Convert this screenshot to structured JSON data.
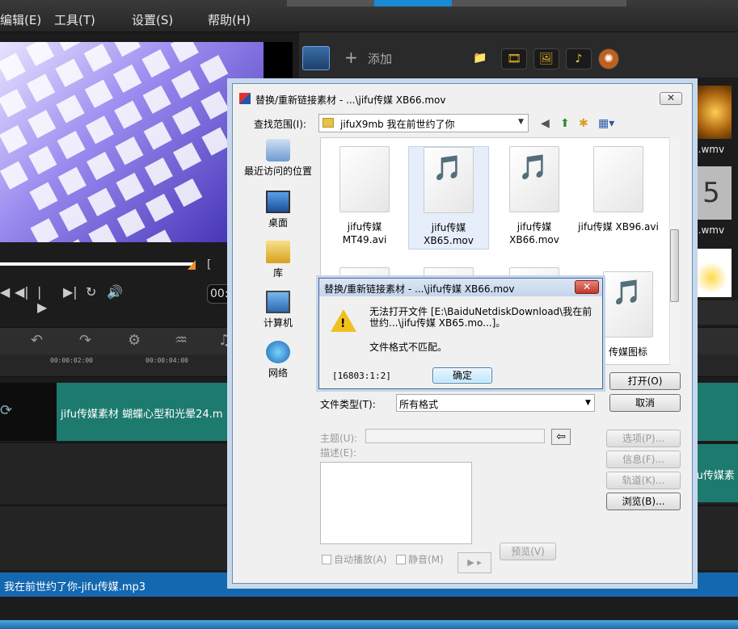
{
  "menu": {
    "edit": "编辑(E)",
    "tools": "工具(T)",
    "settings": "设置(S)",
    "help": "帮助(H)"
  },
  "player": {
    "timecode": "00:"
  },
  "library": {
    "add_label": "添加",
    "thumb1_label": "5.wmv",
    "thumb2_label": "2.wmv",
    "thumb2_text": "5"
  },
  "timeline": {
    "ticks": [
      "00:00:02:00",
      "00:00:04:00"
    ],
    "clip1": "jifu传媒素材 蝴蝶心型和光晕24.m",
    "clip2": "fu传媒素",
    "audio": "我在前世约了你-jifu传媒.mp3"
  },
  "dialog": {
    "title": "替换/重新链接素材 -    ...\\jifu传媒 XB66.mov",
    "close": "✕",
    "lookin_label": "查找范围(I):",
    "lookin_value": "jifuX9mb 我在前世约了你",
    "places": [
      "最近访问的位置",
      "桌面",
      "库",
      "计算机",
      "网络"
    ],
    "files": [
      {
        "name": "jifu传媒 MT49.avi",
        "media": false
      },
      {
        "name": "jifu传媒 XB65.mov",
        "media": true
      },
      {
        "name": "jifu传媒 XB66.mov",
        "media": true
      },
      {
        "name": "jifu传媒 XB96.avi",
        "media": false
      }
    ],
    "partial_file": "传媒图标",
    "open_button": "打开(O)",
    "cancel_button": "取消",
    "filetype_label": "文件类型(T):",
    "filetype_value": "所有格式",
    "subject_label": "主题(U):",
    "description_label": "描述(E):",
    "options_button": "选项(P)...",
    "info_button": "信息(F)...",
    "tracks_button": "轨道(K)...",
    "browse_button": "浏览(B)...",
    "autoplay_label": "自动播放(A)",
    "mute_label": "静音(M)",
    "preview_button": "预览(V)"
  },
  "error": {
    "title": "替换/重新链接素材 -    ...\\jifu传媒 XB66.mov",
    "message_line1": "无法打开文件 [E:\\BaiduNetdiskDownload\\我在前世约...\\jifu传媒 XB65.mo...]。",
    "message_line2": "文件格式不匹配。",
    "code": "[16803:1:2]",
    "ok_button": "确定"
  }
}
